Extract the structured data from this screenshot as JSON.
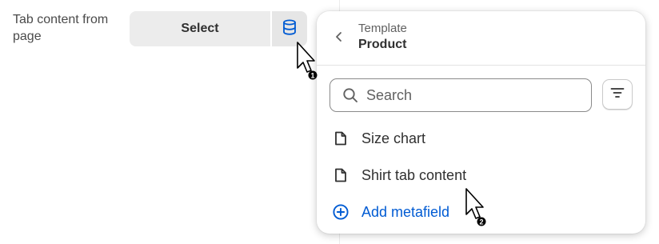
{
  "field": {
    "label": "Tab content from page",
    "select_label": "Select",
    "source_icon": "database-icon"
  },
  "popover": {
    "subtitle": "Template",
    "title": "Product",
    "back_icon": "chevron-left-icon",
    "search": {
      "placeholder": "Search",
      "value": ""
    },
    "filter_icon": "filter-icon",
    "items": [
      {
        "label": "Size chart",
        "icon": "page-icon"
      },
      {
        "label": "Shirt tab content",
        "icon": "page-icon"
      },
      {
        "label": "Add metafield",
        "icon": "plus-circle-icon"
      }
    ]
  },
  "cursors": [
    {
      "badge": "1"
    },
    {
      "badge": "2"
    }
  ],
  "colors": {
    "accent": "#005bd3",
    "text": "#303030",
    "muted": "#616161",
    "button_bg": "#ececec"
  }
}
